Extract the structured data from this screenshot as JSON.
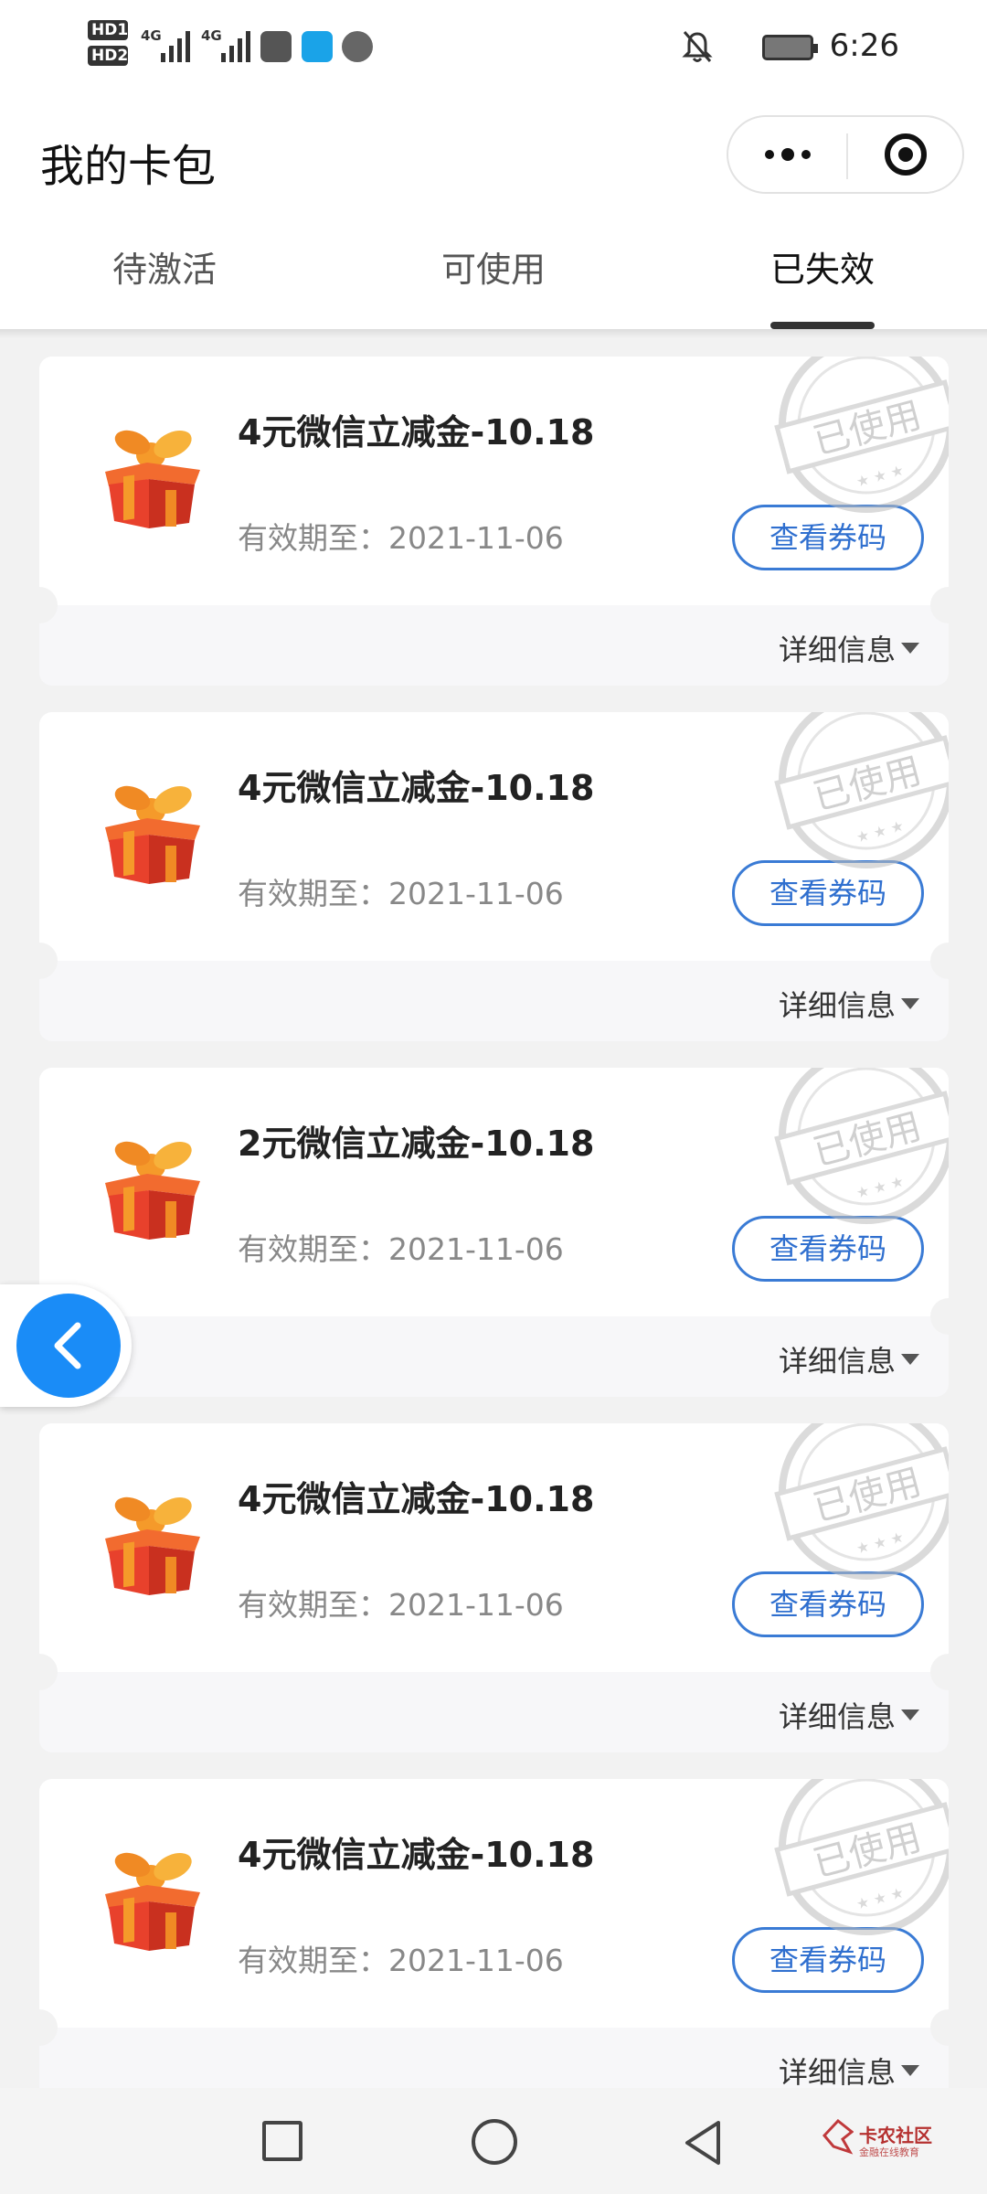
{
  "status_bar": {
    "sim1_label": "HD1",
    "sim2_label": "HD2",
    "network1": "4G",
    "network2": "4G",
    "time": "6:26"
  },
  "header": {
    "title": "我的卡包",
    "tabs": [
      {
        "label": "待激活"
      },
      {
        "label": "可使用"
      },
      {
        "label": "已失效"
      }
    ],
    "active_tab": "已失效"
  },
  "coupons": [
    {
      "title": "4元微信立减金-10.18",
      "expiry": "有效期至：2021-11-06",
      "button": "查看券码",
      "details": "详细信息",
      "stamp": "已使用"
    },
    {
      "title": "4元微信立减金-10.18",
      "expiry": "有效期至：2021-11-06",
      "button": "查看券码",
      "details": "详细信息",
      "stamp": "已使用"
    },
    {
      "title": "2元微信立减金-10.18",
      "expiry": "有效期至：2021-11-06",
      "button": "查看券码",
      "details": "详细信息",
      "stamp": "已使用"
    },
    {
      "title": "4元微信立减金-10.18",
      "expiry": "有效期至：2021-11-06",
      "button": "查看券码",
      "details": "详细信息",
      "stamp": "已使用"
    },
    {
      "title": "4元微信立减金-10.18",
      "expiry": "有效期至：2021-11-06",
      "button": "查看券码",
      "details": "详细信息",
      "stamp": "已使用"
    }
  ],
  "watermark": {
    "text": "卡农社区",
    "sub": "金融在线教育"
  },
  "colors": {
    "accent": "#1a8cf7",
    "button_border": "#3a7bd5",
    "gift_red": "#e8412c",
    "gift_orange": "#f59a2a"
  },
  "icons": {
    "back": "chevron-left-icon",
    "more": "more-dots-icon",
    "close": "mini-program-close-icon",
    "gift": "gift-box-icon"
  }
}
